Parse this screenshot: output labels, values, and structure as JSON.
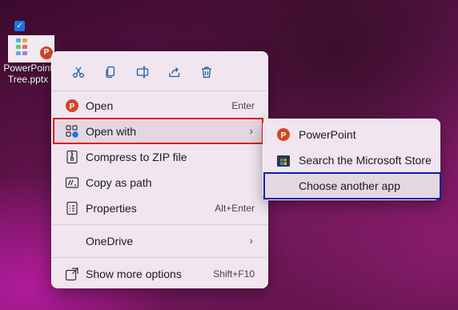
{
  "desktop": {
    "file_label_line1": "PowerPoint",
    "file_label_line2": "Tree.pptx",
    "check_glyph": "✓"
  },
  "toolbar": [
    {
      "name": "cut-icon",
      "glyph": "✂"
    },
    {
      "name": "copy-icon",
      "glyph": "copy"
    },
    {
      "name": "rename-icon",
      "glyph": "rename"
    },
    {
      "name": "share-icon",
      "glyph": "share"
    },
    {
      "name": "delete-icon",
      "glyph": "trash"
    }
  ],
  "menu": {
    "open": {
      "label": "Open",
      "shortcut": "Enter"
    },
    "open_with": {
      "label": "Open with"
    },
    "compress": {
      "label": "Compress to ZIP file"
    },
    "copy_path": {
      "label": "Copy as path"
    },
    "properties": {
      "label": "Properties",
      "shortcut": "Alt+Enter"
    },
    "onedrive": {
      "label": "OneDrive"
    },
    "more_options": {
      "label": "Show more options",
      "shortcut": "Shift+F10"
    },
    "arrow_glyph": "›"
  },
  "submenu": {
    "powerpoint": {
      "label": "PowerPoint"
    },
    "store": {
      "label": "Search the Microsoft Store"
    },
    "choose": {
      "label": "Choose another app"
    }
  },
  "colors": {
    "highlight_red": "#e0191e",
    "highlight_blue": "#0a1fb0",
    "powerpoint": "#d24726",
    "accent": "#1a73e8"
  }
}
